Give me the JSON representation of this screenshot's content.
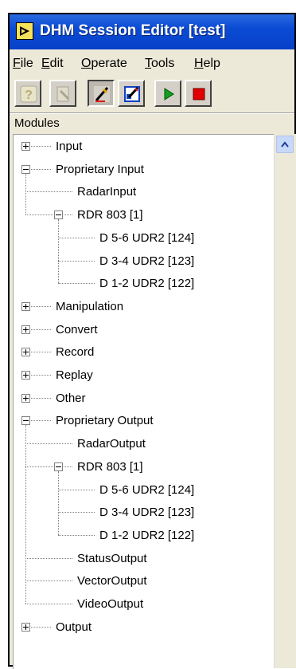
{
  "window": {
    "title": "DHM Session Editor [test]"
  },
  "menu": [
    {
      "id": "file",
      "mnemonic": "F",
      "rest": "ile"
    },
    {
      "id": "edit",
      "mnemonic": "E",
      "rest": "dit"
    },
    {
      "id": "operate",
      "mnemonic": "O",
      "rest": "perate"
    },
    {
      "id": "tools",
      "mnemonic": "T",
      "rest": "ools"
    },
    {
      "id": "help",
      "mnemonic": "H",
      "rest": "elp"
    }
  ],
  "toolbar": [
    {
      "name": "help-button",
      "icon": "help-icon",
      "state": "disabled"
    },
    {
      "name": "properties-button",
      "icon": "properties-icon",
      "state": "disabled"
    },
    {
      "name": "edit-mode-button",
      "icon": "edit-pencil-icon",
      "state": "pressed"
    },
    {
      "name": "configure-button",
      "icon": "configure-icon",
      "state": "normal"
    },
    {
      "name": "run-button",
      "icon": "play-icon",
      "state": "normal"
    },
    {
      "name": "stop-button",
      "icon": "stop-icon",
      "state": "normal"
    }
  ],
  "panel": {
    "label": "Modules"
  },
  "tree": [
    {
      "label": "Input",
      "level": 0,
      "expander": "plus"
    },
    {
      "label": "Proprietary Input",
      "level": 0,
      "expander": "minus"
    },
    {
      "label": "RadarInput",
      "level": 1,
      "expander": "none"
    },
    {
      "label": "RDR 803 [1]",
      "level": 1,
      "expander": "minus"
    },
    {
      "label": "D 5-6 UDR2 [124]",
      "level": 2,
      "expander": "none"
    },
    {
      "label": "D 3-4 UDR2 [123]",
      "level": 2,
      "expander": "none"
    },
    {
      "label": "D 1-2 UDR2 [122]",
      "level": 2,
      "expander": "none"
    },
    {
      "label": "Manipulation",
      "level": 0,
      "expander": "plus"
    },
    {
      "label": "Convert",
      "level": 0,
      "expander": "plus"
    },
    {
      "label": "Record",
      "level": 0,
      "expander": "plus"
    },
    {
      "label": "Replay",
      "level": 0,
      "expander": "plus"
    },
    {
      "label": "Other",
      "level": 0,
      "expander": "plus"
    },
    {
      "label": "Proprietary Output",
      "level": 0,
      "expander": "minus"
    },
    {
      "label": "RadarOutput",
      "level": 1,
      "expander": "none"
    },
    {
      "label": "RDR 803 [1]",
      "level": 1,
      "expander": "minus"
    },
    {
      "label": "D 5-6 UDR2 [124]",
      "level": 2,
      "expander": "none"
    },
    {
      "label": "D 3-4 UDR2 [123]",
      "level": 2,
      "expander": "none"
    },
    {
      "label": "D 1-2 UDR2 [122]",
      "level": 2,
      "expander": "none"
    },
    {
      "label": "StatusOutput",
      "level": 1,
      "expander": "none"
    },
    {
      "label": "VectorOutput",
      "level": 1,
      "expander": "none"
    },
    {
      "label": "VideoOutput",
      "level": 1,
      "expander": "none"
    },
    {
      "label": "Output",
      "level": 0,
      "expander": "plus"
    }
  ],
  "scrollbar": {
    "up_icon": "scroll-up-arrow-icon"
  }
}
